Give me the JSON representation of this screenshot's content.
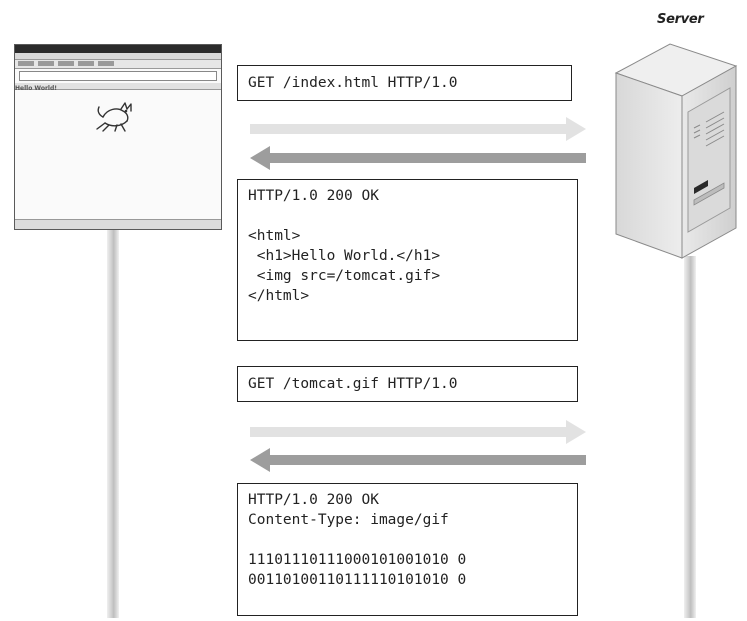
{
  "client": {
    "window": {
      "page_heading": "Hello World!"
    }
  },
  "server": {
    "label": "Server"
  },
  "messages": [
    {
      "direction": "request",
      "lines": [
        "GET /index.html HTTP/1.0"
      ]
    },
    {
      "direction": "response",
      "lines": [
        "HTTP/1.0 200 OK",
        "",
        "<html>",
        " <h1>Hello World.</h1>",
        " <img src=/tomcat.gif>",
        "</html>"
      ]
    },
    {
      "direction": "request",
      "lines": [
        "GET /tomcat.gif HTTP/1.0"
      ]
    },
    {
      "direction": "response",
      "lines": [
        "HTTP/1.0 200 OK",
        "Content-Type: image/gif",
        "",
        "11101110111000101001010 0",
        "00110100110111110101010 0"
      ]
    }
  ],
  "colors": {
    "arrow_light": "#e2e2e2",
    "arrow_dark": "#9d9d9d",
    "box_border": "#222222",
    "lifeline": "#c6c6c6"
  }
}
